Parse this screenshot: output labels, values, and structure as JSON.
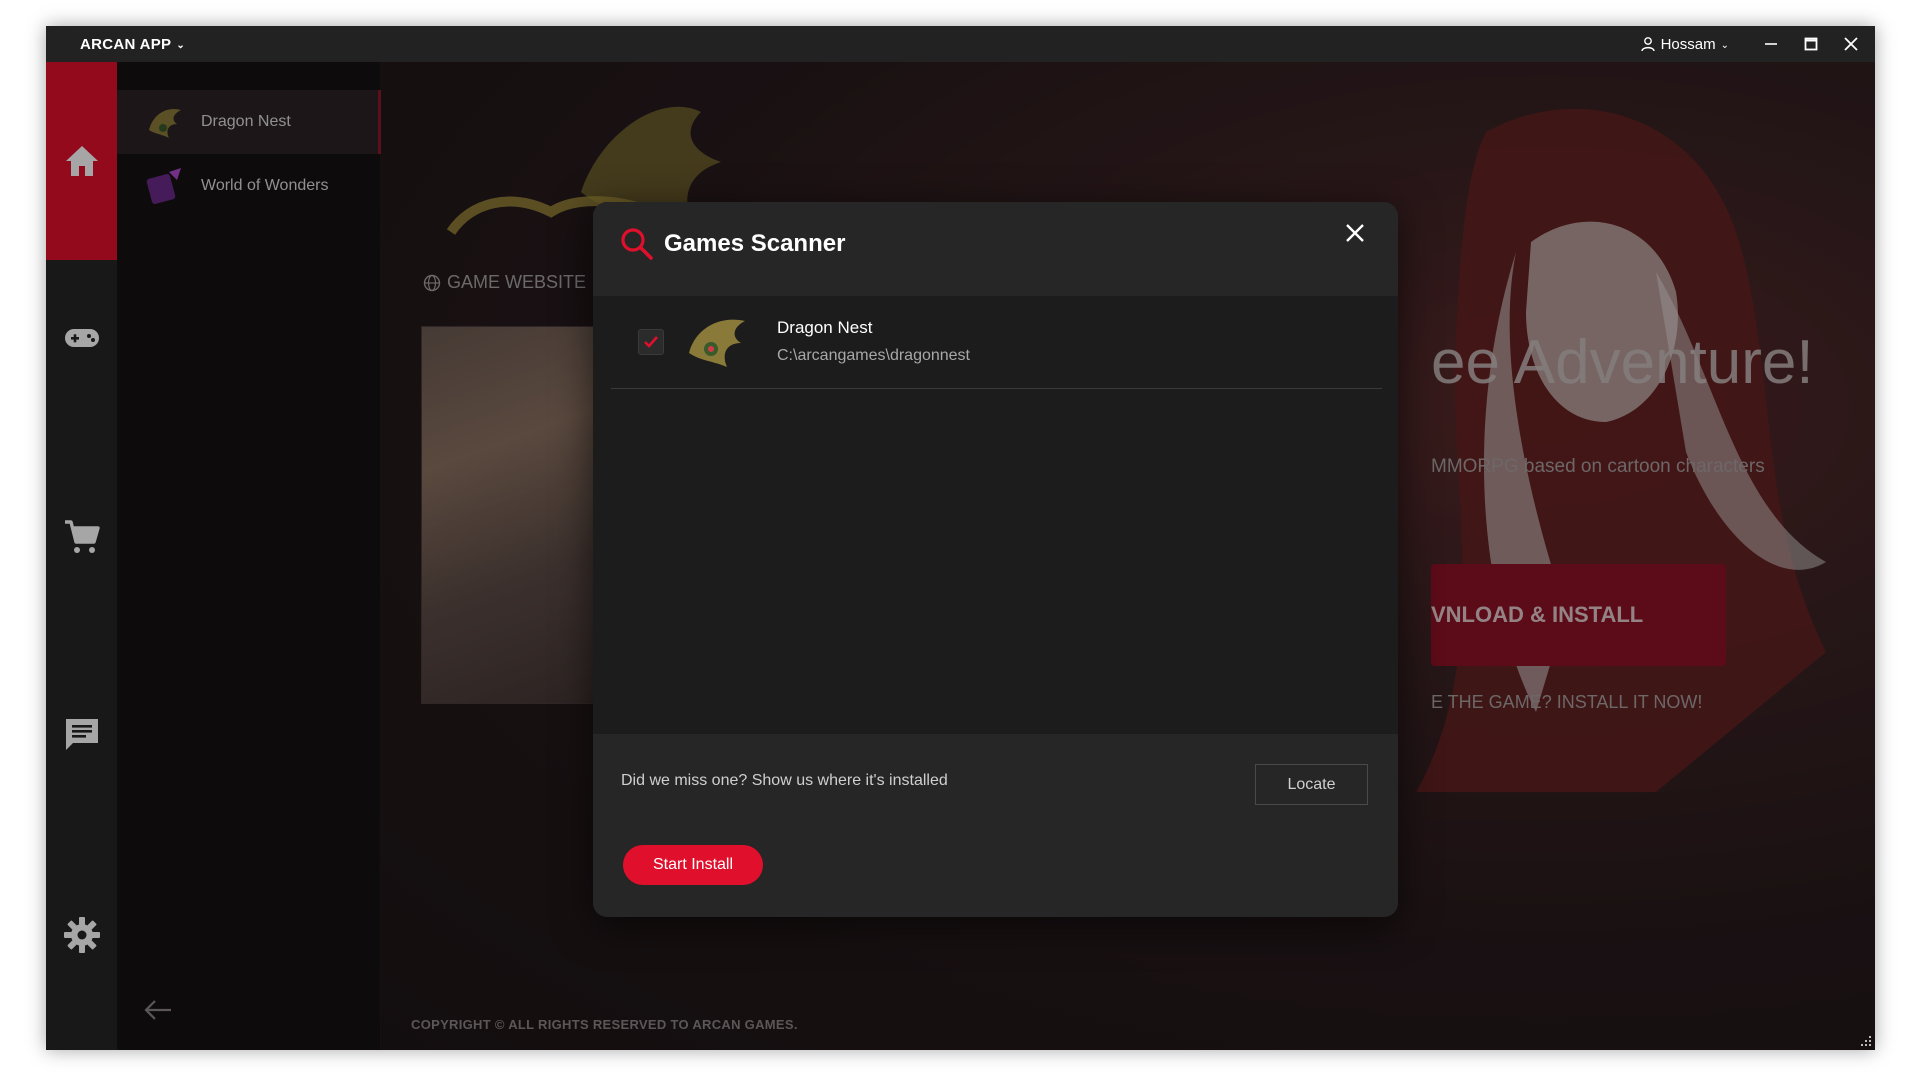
{
  "titlebar": {
    "app_name": "ARCAN APP",
    "user_name": "Hossam"
  },
  "rail": {
    "items": [
      {
        "name": "home",
        "icon": "home-icon"
      },
      {
        "name": "games",
        "icon": "gamepad-icon"
      },
      {
        "name": "store",
        "icon": "cart-icon"
      },
      {
        "name": "chat",
        "icon": "chat-icon"
      },
      {
        "name": "settings",
        "icon": "gear-icon"
      }
    ],
    "active": "home"
  },
  "gamelist": {
    "items": [
      {
        "label": "Dragon Nest",
        "active": true
      },
      {
        "label": "World of Wonders",
        "active": false
      }
    ]
  },
  "main": {
    "site_link": "GAME WEBSITE",
    "hero_title": "ee Adventure!",
    "hero_sub": "MMORPG based on cartoon characters",
    "download_label": "VNLOAD & INSTALL",
    "hero_hint": "E THE GAME? INSTALL IT NOW!",
    "copyright": "COPYRIGHT © ALL RIGHTS RESERVED TO ARCAN GAMES."
  },
  "modal": {
    "title": "Games Scanner",
    "rows": [
      {
        "name": "Dragon Nest",
        "path": "C:\\arcangames\\dragonnest",
        "checked": true
      }
    ],
    "foot_text": "Did we miss one? Show us where it's installed",
    "locate_label": "Locate",
    "start_label": "Start Install"
  },
  "colors": {
    "accent": "#e0102c",
    "rail_bg": "#262626",
    "modal_bg": "#1c1c1c"
  }
}
